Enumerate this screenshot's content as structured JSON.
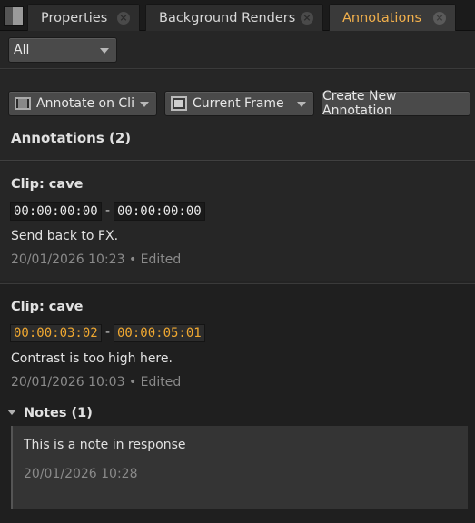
{
  "tabs": [
    {
      "label": "Properties"
    },
    {
      "label": "Background Renders"
    },
    {
      "label": "Annotations",
      "active": true
    }
  ],
  "filter": {
    "selected": "All"
  },
  "toolbar": {
    "annotate_label": "Annotate on Cli",
    "frame_label": "Current Frame",
    "create_label": "Create New Annotation"
  },
  "section": {
    "title": "Annotations (2)"
  },
  "annotations": [
    {
      "clip": "Clip: cave",
      "tc_in": "00:00:00:00",
      "tc_out": "00:00:00:00",
      "text": "Send back to FX.",
      "meta": "20/01/2026 10:23 • Edited"
    },
    {
      "clip": "Clip: cave",
      "tc_in": "00:00:03:02",
      "tc_out": "00:00:05:01",
      "text": "Contrast is too high here.",
      "meta": "20/01/2026 10:03 • Edited",
      "notes_header": "Notes (1)",
      "note": {
        "text": "This is a note in response",
        "time": "20/01/2026 10:28"
      }
    }
  ],
  "separator": "-",
  "colors": {
    "accent": "#f2b04c",
    "timecode_highlight": "#f0a830",
    "background": "#232323"
  }
}
